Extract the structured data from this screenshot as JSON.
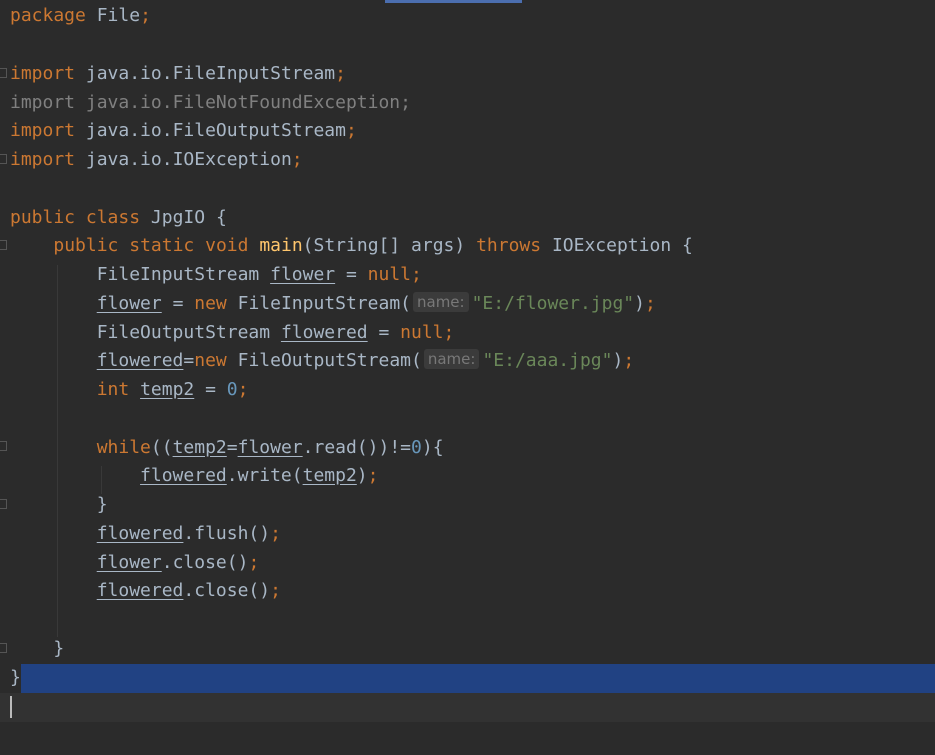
{
  "code": {
    "package_kw": "package",
    "package_name": "File",
    "semicolon": ";",
    "import_kw": "import",
    "imports": [
      "java.io.FileInputStream",
      "java.io.FileNotFoundException",
      "java.io.FileOutputStream",
      "java.io.IOException"
    ],
    "class_decl": {
      "public": "public",
      "class": "class",
      "name": "JpgIO",
      "brace": "{"
    },
    "method_decl": {
      "public": "public",
      "static": "static",
      "void": "void",
      "name": "main",
      "params": "(String[] args)",
      "throws": "throws",
      "exception": "IOException",
      "brace": "{"
    },
    "stmt1": {
      "type": "FileInputStream",
      "var": "flower",
      "eq": " = ",
      "null": "null"
    },
    "stmt2": {
      "var": "flower",
      "eq": " = ",
      "new": "new",
      "ctor": " FileInputStream(",
      "hint": "name:",
      "arg": "\"E:/flower.jpg\"",
      "close": ")"
    },
    "stmt3": {
      "type": "FileOutputStream",
      "var": "flowered",
      "eq": " = ",
      "null": "null"
    },
    "stmt4": {
      "var": "flowered",
      "eq": "=",
      "new": "new",
      "ctor": " FileOutputStream(",
      "hint": "name:",
      "arg": "\"E:/aaa.jpg\"",
      "close": ")"
    },
    "stmt5": {
      "type": "int",
      "var": "temp2",
      "eq": " = ",
      "val": "0"
    },
    "while_stmt": {
      "kw": "while",
      "open": "((",
      "var1": "temp2",
      "eq": "=",
      "var2": "flower",
      "call": ".read())!=",
      "val": "0",
      "close": "){"
    },
    "write_stmt": {
      "var": "flowered",
      "call": ".write(",
      "arg": "temp2",
      "close": ")"
    },
    "close_brace": "}",
    "flush_stmt": {
      "var": "flowered",
      "call": ".flush()"
    },
    "close1_stmt": {
      "var": "flower",
      "call": ".close()"
    },
    "close2_stmt": {
      "var": "flowered",
      "call": ".close()"
    }
  }
}
